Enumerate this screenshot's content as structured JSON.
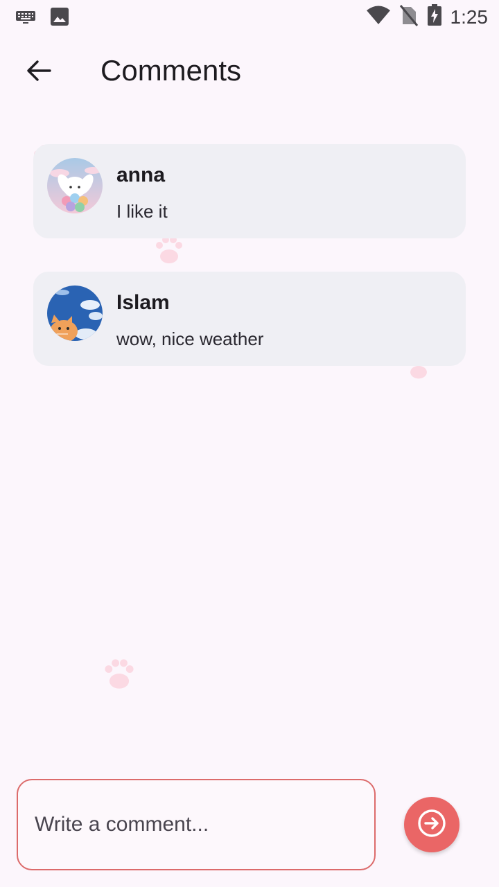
{
  "status_bar": {
    "time": "1:25",
    "icons": [
      "keyboard-icon",
      "image-icon",
      "wifi-icon",
      "no-sim-icon",
      "battery-charging-icon"
    ]
  },
  "header": {
    "title": "Comments",
    "back_icon": "arrow-left-icon"
  },
  "comments": [
    {
      "name": "anna",
      "text": "I like it",
      "avatar": "bunny-with-flowers-avatar"
    },
    {
      "name": "Islam",
      "text": "wow, nice weather",
      "avatar": "cat-under-blue-sky-avatar"
    }
  ],
  "composer": {
    "placeholder": "Write a comment...",
    "value": "",
    "send_icon": "arrow-right-circle-icon"
  },
  "colors": {
    "background": "#fcf6fc",
    "card": "#efeff4",
    "accent": "#ea6666",
    "input_border": "#dc6b6b",
    "paw": "#fbd9e3"
  }
}
